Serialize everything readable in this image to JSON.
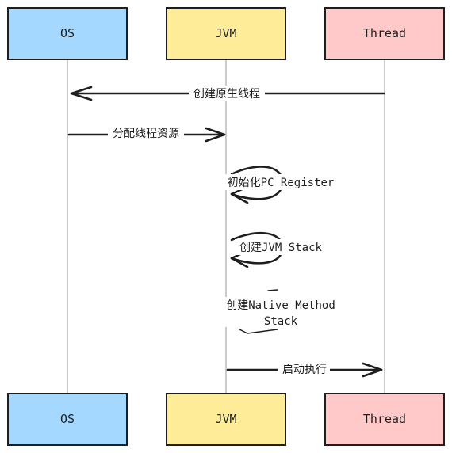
{
  "participants": {
    "os": {
      "label": "OS",
      "fill": "#a5d8ff"
    },
    "jvm": {
      "label": "JVM",
      "fill": "#ffec99"
    },
    "thread": {
      "label": "Thread",
      "fill": "#ffc9c9"
    }
  },
  "messages": {
    "m1": {
      "text": "创建原生线程"
    },
    "m2": {
      "text": "分配线程资源"
    },
    "m3": {
      "text": "初始化PC Register"
    },
    "m4": {
      "text": "创建JVM Stack"
    },
    "m5": {
      "line1": "创建Native Method",
      "line2": "Stack"
    },
    "m6": {
      "text": "启动执行"
    }
  }
}
